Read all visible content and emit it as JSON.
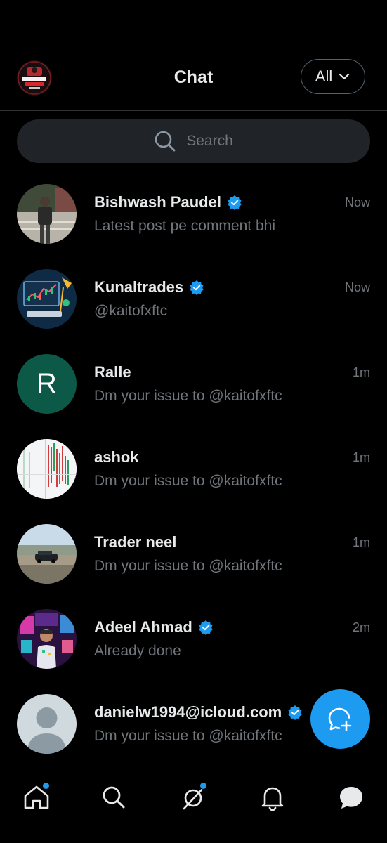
{
  "header": {
    "title": "Chat",
    "filter_label": "All",
    "logo_icon": "prop-firm-scam-report-logo"
  },
  "search": {
    "placeholder": "Search"
  },
  "chats": [
    {
      "name": "Bishwash Paudel",
      "verified": true,
      "time": "Now",
      "preview": "Latest post pe comment bhi"
    },
    {
      "name": "Kunaltrades",
      "verified": true,
      "time": "Now",
      "preview": "@kaitofxftc"
    },
    {
      "name": "Ralle",
      "verified": false,
      "time": "1m",
      "preview": "Dm your issue to @kaitofxftc",
      "avatar_letter": "R"
    },
    {
      "name": "ashok",
      "verified": false,
      "time": "1m",
      "preview": "Dm your issue to @kaitofxftc"
    },
    {
      "name": "Trader neel",
      "verified": false,
      "time": "1m",
      "preview": "Dm your issue to @kaitofxftc"
    },
    {
      "name": "Adeel Ahmad",
      "verified": true,
      "time": "2m",
      "preview": "Already done"
    },
    {
      "name": "danielw1994@icloud.com",
      "verified": true,
      "time": "",
      "preview": "Dm your issue to @kaitofxftc"
    }
  ],
  "colors": {
    "accent": "#1d9bf0",
    "background": "#000000",
    "secondary_text": "#71767b",
    "avatar_r_bg": "#0c5947"
  },
  "nav": [
    {
      "icon": "home-icon",
      "has_dot": true
    },
    {
      "icon": "search-icon",
      "has_dot": false
    },
    {
      "icon": "grok-icon",
      "has_dot": true
    },
    {
      "icon": "bell-icon",
      "has_dot": false
    },
    {
      "icon": "chat-bubble-icon",
      "has_dot": false
    }
  ],
  "fab": {
    "icon": "new-chat-icon"
  }
}
